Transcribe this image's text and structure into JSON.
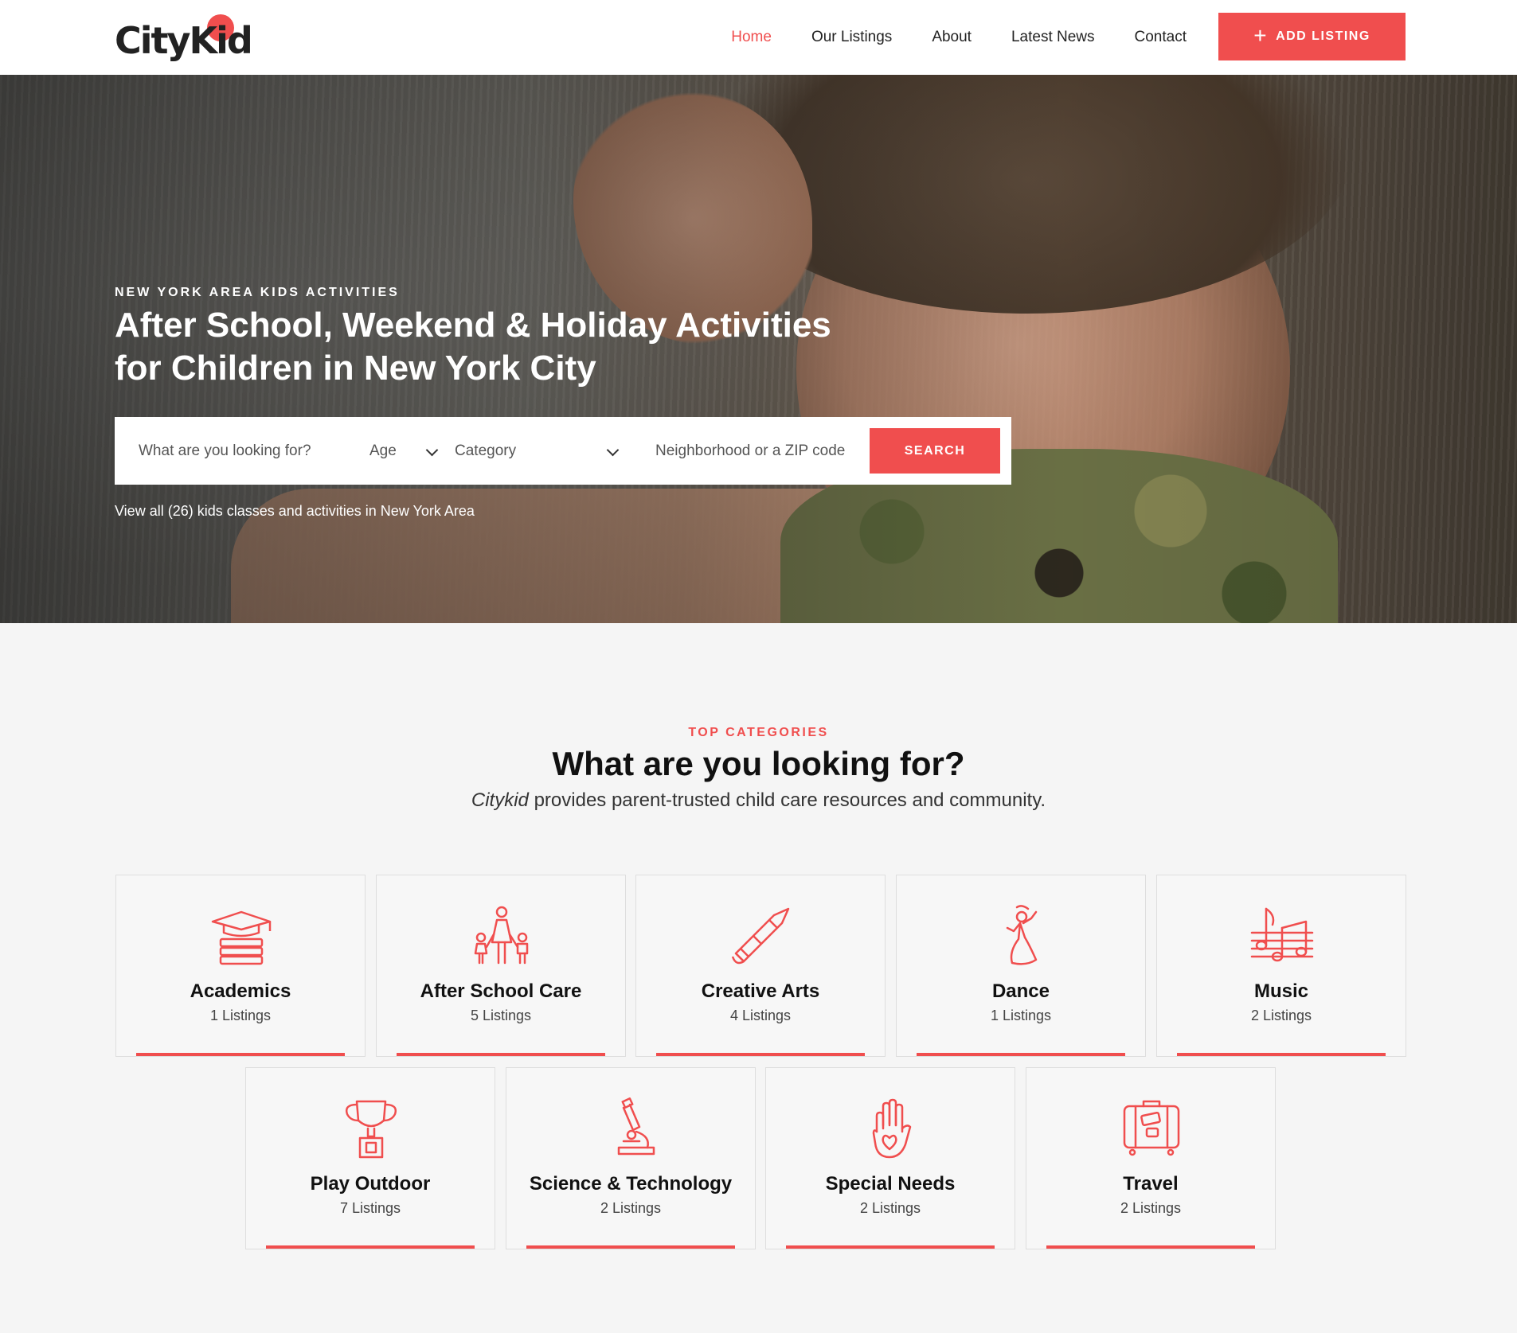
{
  "brand": {
    "name": "CityKid",
    "accent": "#f04e4e"
  },
  "nav": {
    "items": [
      {
        "label": "Home",
        "active": true
      },
      {
        "label": "Our Listings",
        "active": false
      },
      {
        "label": "About",
        "active": false
      },
      {
        "label": "Latest News",
        "active": false
      },
      {
        "label": "Contact",
        "active": false
      }
    ],
    "add_listing": "ADD LISTING"
  },
  "hero": {
    "eyebrow": "NEW YORK AREA KIDS ACTIVITIES",
    "title": "After School, Weekend & Holiday Activities for Children in New York City",
    "search": {
      "what_placeholder": "What are you looking for?",
      "age_label": "Age",
      "category_label": "Category",
      "zip_placeholder": "Neighborhood or a ZIP code",
      "button": "SEARCH"
    },
    "view_all": "View all (26) kids classes and activities in New York Area"
  },
  "categories": {
    "eyebrow": "TOP CATEGORIES",
    "title": "What are you looking for?",
    "subtitle_brand": "Citykid",
    "subtitle_rest": " provides parent-trusted child care resources and community.",
    "items": [
      {
        "name": "Academics",
        "count": "1 Listings",
        "icon": "books-icon"
      },
      {
        "name": "After School Care",
        "count": "5 Listings",
        "icon": "family-icon"
      },
      {
        "name": "Creative Arts",
        "count": "4 Listings",
        "icon": "pencil-icon"
      },
      {
        "name": "Dance",
        "count": "1 Listings",
        "icon": "dancer-icon"
      },
      {
        "name": "Music",
        "count": "2 Listings",
        "icon": "music-notes-icon"
      },
      {
        "name": "Play Outdoor",
        "count": "7 Listings",
        "icon": "trophy-icon"
      },
      {
        "name": "Science & Technology",
        "count": "2 Listings",
        "icon": "microscope-icon"
      },
      {
        "name": "Special Needs",
        "count": "2 Listings",
        "icon": "hand-heart-icon"
      },
      {
        "name": "Travel",
        "count": "2 Listings",
        "icon": "suitcase-icon"
      }
    ]
  }
}
